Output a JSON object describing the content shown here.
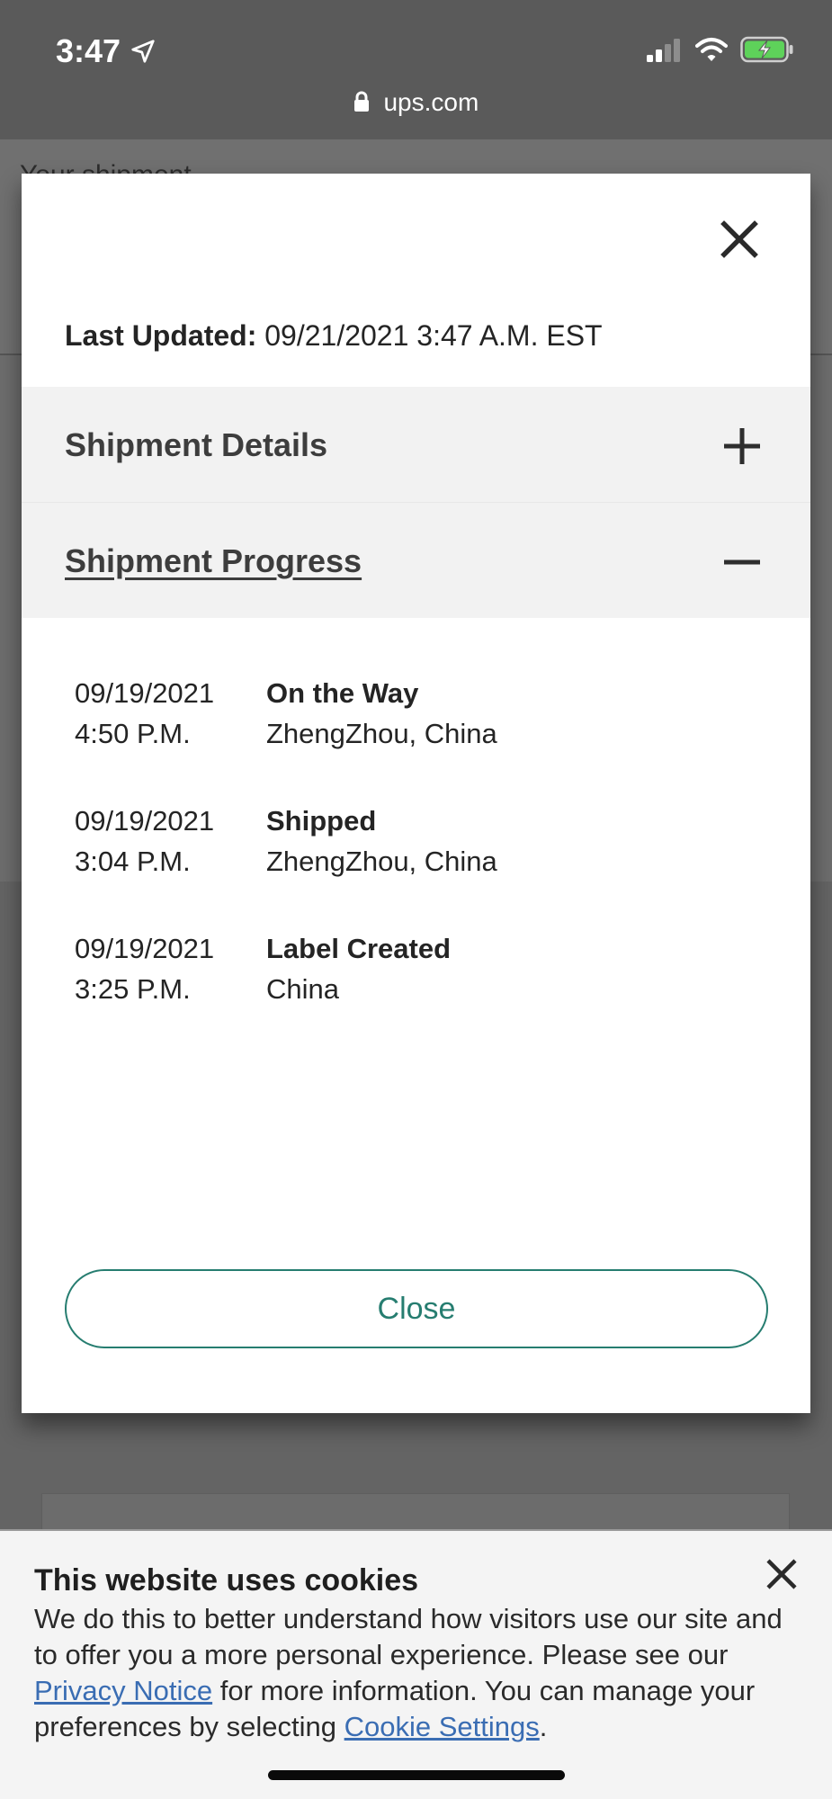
{
  "status_bar": {
    "time": "3:47",
    "url": "ups.com"
  },
  "background": {
    "peek_text": "Your shipment"
  },
  "modal": {
    "last_updated_label": "Last Updated:",
    "last_updated_value": "09/21/2021 3:47 A.M. EST",
    "sections": [
      {
        "title": "Shipment Details",
        "expanded": false
      },
      {
        "title": "Shipment Progress",
        "expanded": true
      }
    ],
    "events": [
      {
        "date": "09/19/2021",
        "time": "4:50 P.M.",
        "status": "On the Way",
        "location": "ZhengZhou, China"
      },
      {
        "date": "09/19/2021",
        "time": "3:04 P.M.",
        "status": "Shipped",
        "location": "ZhengZhou, China"
      },
      {
        "date": "09/19/2021",
        "time": "3:25 P.M.",
        "status": "Label Created",
        "location": "China"
      }
    ],
    "close_label": "Close"
  },
  "cookie_banner": {
    "title": "This website uses cookies",
    "text_1": "We do this to better understand how visitors use our site and to offer you a more personal experience. Please see our ",
    "privacy_link": "Privacy Notice",
    "text_2": " for more information. You can manage your preferences by selecting ",
    "settings_link": "Cookie Settings",
    "text_3": "."
  },
  "colors": {
    "accent": "#267d70",
    "link": "#3a6db3",
    "accordion_bg": "#f2f2f2"
  },
  "icons": {
    "location": "location-arrow-icon",
    "signal": "cellular-signal-icon",
    "wifi": "wifi-icon",
    "battery": "battery-charging-icon",
    "lock": "lock-icon",
    "close": "close-icon",
    "expand": "plus-icon",
    "collapse": "minus-icon"
  }
}
